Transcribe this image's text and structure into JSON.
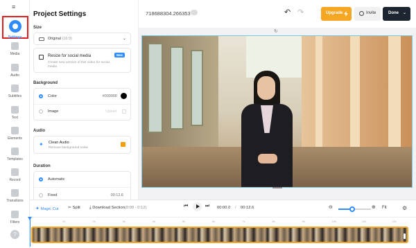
{
  "rail": {
    "items": [
      {
        "label": "Settings",
        "icon": "settings-icon"
      },
      {
        "label": "Media",
        "icon": "plus-icon"
      },
      {
        "label": "Audio",
        "icon": "music-icon"
      },
      {
        "label": "Subtitles",
        "icon": "subtitles-icon"
      },
      {
        "label": "Text",
        "icon": "text-icon"
      },
      {
        "label": "Elements",
        "icon": "elements-icon"
      },
      {
        "label": "Templates",
        "icon": "templates-icon"
      },
      {
        "label": "Record",
        "icon": "record-icon"
      },
      {
        "label": "Transitions",
        "icon": "transitions-icon"
      },
      {
        "label": "Filters",
        "icon": "filters-icon"
      }
    ],
    "help": "?"
  },
  "panel": {
    "title": "Project Settings",
    "size": {
      "label": "Size",
      "select_value": "Original",
      "select_ratio": "(16:9)"
    },
    "resize": {
      "title": "Resize for social media",
      "description": "Create new version of this video for social media",
      "badge": "New"
    },
    "background": {
      "label": "Background",
      "color_label": "Color",
      "color_value": "#000000",
      "image_label": "Image",
      "upload": "Upload"
    },
    "audio": {
      "label": "Audio",
      "title": "Clean Audio",
      "description": "Remove background noise"
    },
    "duration": {
      "label": "Duration",
      "automatic": "Automatic",
      "fixed": "Fixed",
      "fixed_value": "00:12.6"
    }
  },
  "topbar": {
    "project_id": "718688304.266353",
    "upgrade": "Upgrade",
    "invite": "Invite",
    "done": "Done"
  },
  "timeline": {
    "magic_cut": "Magic Cut",
    "split": "Split",
    "download": "Download Section",
    "download_range": "(0:00 - 0:12)",
    "current_time": "00:00.0",
    "separator": "/",
    "total_time": "00:12.6",
    "fit": "Fit",
    "zoom_level": 0.42,
    "ticks": [
      "1s",
      "2s",
      "3s",
      "4s",
      "5s",
      "6s",
      "7s",
      "8s",
      "9s",
      "10s",
      "11s",
      "12s"
    ]
  },
  "colors": {
    "accent": "#2f8cff",
    "upgrade": "#f5a623",
    "done": "#1c2530"
  }
}
